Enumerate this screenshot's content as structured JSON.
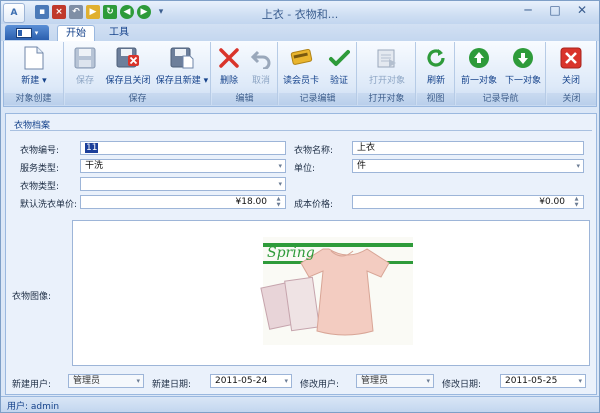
{
  "window": {
    "title": "上衣 - 衣物和...",
    "app_icon_text": "A"
  },
  "quick_access": {
    "icons": [
      "save-icon",
      "close-save-icon",
      "undo-icon",
      "open-icon",
      "refresh-icon",
      "back-icon",
      "forward-icon",
      "dropdown-arrow-icon"
    ]
  },
  "tabs": [
    {
      "label": "开始",
      "active": true
    },
    {
      "label": "工具",
      "active": false
    }
  ],
  "ribbon": {
    "groups": {
      "object_create": "对象创建",
      "save": "保存",
      "edit": "编辑",
      "record_edit": "记录编辑",
      "open_object": "打开对象",
      "view": "视图",
      "record_nav": "记录导航",
      "close": "关闭"
    },
    "buttons": {
      "new": "新建",
      "save": "保存",
      "save_close": "保存且关闭",
      "save_new": "保存且新建",
      "delete": "删除",
      "cancel": "取消",
      "read_card": "读会员卡",
      "verify": "验证",
      "open_object": "打开对象",
      "refresh": "刷新",
      "prev": "前一对象",
      "next": "下一对象",
      "close": "关闭"
    }
  },
  "form": {
    "section_title": "衣物档案",
    "labels": {
      "code": "衣物编号:",
      "name": "衣物名称:",
      "service_type": "服务类型:",
      "unit": "单位:",
      "clothes_type": "衣物类型:",
      "default_price": "默认洗衣单价:",
      "cost_price": "成本价格:",
      "image": "衣物图像:",
      "create_user": "新建用户:",
      "create_date": "新建日期:",
      "modify_user": "修改用户:",
      "modify_date": "修改日期:"
    },
    "values": {
      "code": "11",
      "name": "上衣",
      "service_type": "干洗",
      "unit": "件",
      "clothes_type": "",
      "default_price": "¥18.00",
      "cost_price": "¥0.00",
      "create_user": "管理员",
      "create_date": "2011-05-24",
      "modify_user": "管理员",
      "modify_date": "2011-05-25"
    },
    "image_text": "Spring"
  },
  "status": {
    "text": "用户: admin"
  },
  "colors": {
    "accent": "#15428b",
    "ribbon_bg": "#dde9f8",
    "close_red": "#d9342b",
    "nav_green": "#2e9b3a"
  }
}
